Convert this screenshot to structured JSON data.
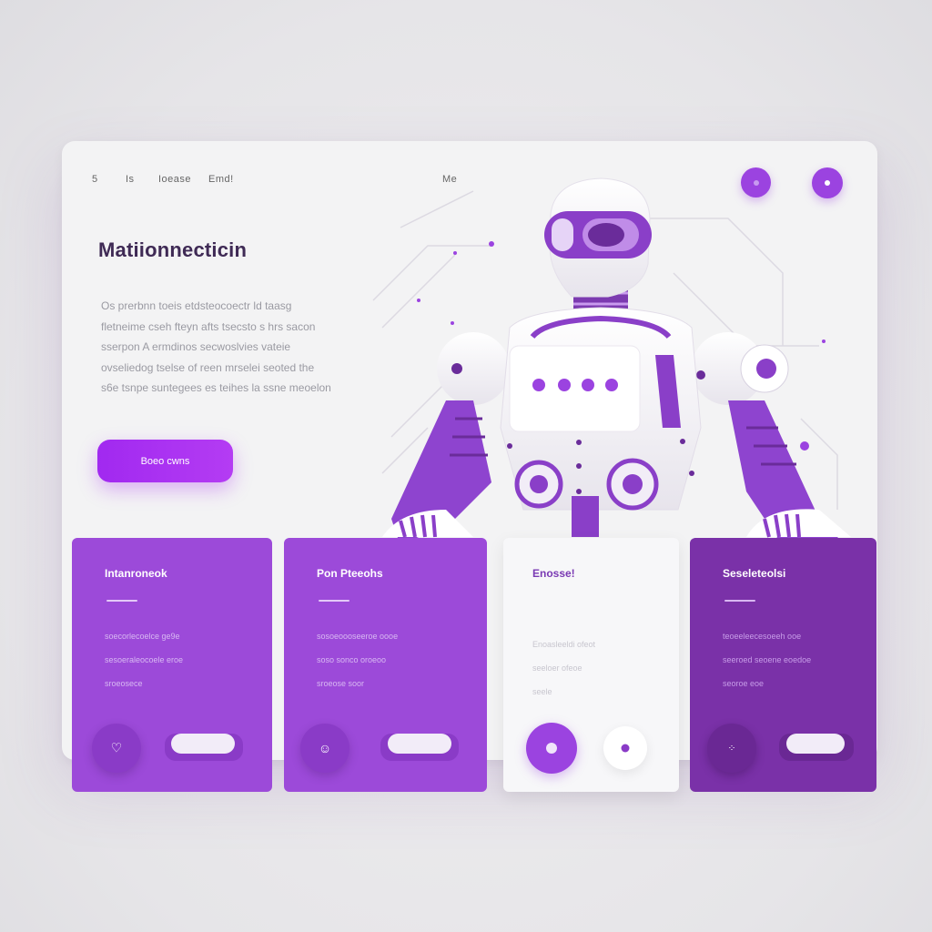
{
  "colors": {
    "accent": "#9b43e0",
    "card_purple": "#9c4ad9",
    "card_dark_purple": "#7a31a8",
    "title": "#3f2a55"
  },
  "nav": {
    "items": [
      "5",
      "Is",
      "Ioease",
      "Emd!"
    ],
    "right_label": "Me"
  },
  "header_actions": [
    {
      "icon": "dot-icon"
    },
    {
      "icon": "dot-icon"
    }
  ],
  "hero": {
    "title": "Matiionnecticin",
    "paragraph": [
      "Os prerbnn toeis etdsteocoectr ld taasg",
      "fletneime cseh fteyn afts tsecsto s hrs sacon",
      "sserpon A ermdinos secwoslvies vateie",
      "ovseliedog tselse of reen mrselei seoted the",
      "s6e tsnpe suntegees es teihes la ssne meoelon"
    ],
    "cta_label": "Boeo cwns"
  },
  "illustration": {
    "name": "robot-illustration"
  },
  "cards": [
    {
      "title": "Intanroneok",
      "lines": [
        "soecorlecoelce ge9e",
        "sesoeraleocoele eroe",
        "sroeosece"
      ],
      "icon": "heart-icon"
    },
    {
      "title": "Pon Pteeohs",
      "lines": [
        "sosoeoooseeroe oooe",
        "soso sonco oroeoo",
        "sroeose soor"
      ],
      "icon": "smile-icon"
    },
    {
      "title": "Enosse!",
      "lines": [
        "Enoasleeldi ofeot",
        "seeloer ofeoe",
        "seele"
      ],
      "icon": "dot-icon"
    },
    {
      "title": "Seseleteolsi",
      "lines": [
        "teoeeleecesoeeh ooe",
        "seeroed seoene eoedoe",
        "seoroe eoe"
      ],
      "icon": "sparkle-icon"
    }
  ]
}
